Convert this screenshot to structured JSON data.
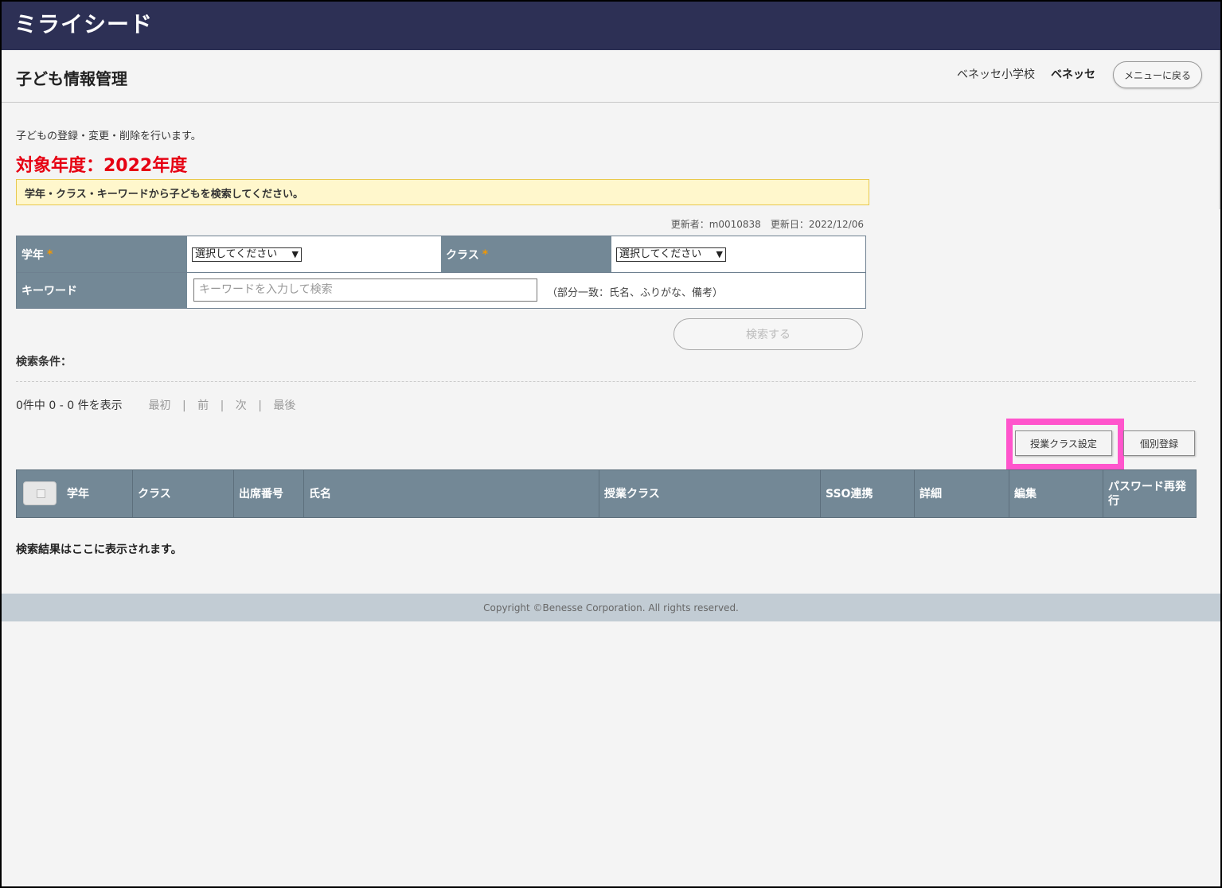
{
  "app": {
    "logo_text": "ミライシード"
  },
  "header": {
    "title": "子ども情報管理",
    "school": "ベネッセ小学校",
    "user": "ベネッセ",
    "menu_button": "メニューに戻る"
  },
  "intro": {
    "description": "子どもの登録・変更・削除を行います。",
    "target_year": "対象年度：2022年度",
    "notice": "学年・クラス・キーワードから子どもを検索してください。",
    "updated_info": "更新者：m0010838　更新日：2022/12/06"
  },
  "form": {
    "grade_label": "学年",
    "class_label": "クラス",
    "required_mark": "*",
    "select_placeholder": "選択してください",
    "keyword_label": "キーワード",
    "keyword_placeholder": "キーワードを入力して検索",
    "keyword_hint": "（部分一致：氏名、ふりがな、備考）",
    "search_button": "検索する"
  },
  "results": {
    "condition_label": "検索条件：",
    "count_text": "0件中 0 - 0 件を表示",
    "paging": {
      "first": "最初",
      "prev": "前",
      "next": "次",
      "last": "最後",
      "separator": "|"
    },
    "class_setting_button": "授業クラス設定",
    "individual_register_button": "個別登録",
    "columns": [
      "学年",
      "クラス",
      "出席番号",
      "氏名",
      "授業クラス",
      "SSO連携",
      "詳細",
      "編集",
      "パスワード再発行"
    ],
    "empty_message": "検索結果はここに表示されます。"
  },
  "footer": {
    "copyright": "Copyright ©Benesse Corporation. All rights reserved."
  },
  "colors": {
    "topbar": "#2d3055",
    "accent_red": "#e60012",
    "highlight": "#ff55cc",
    "table_header": "#738896"
  }
}
